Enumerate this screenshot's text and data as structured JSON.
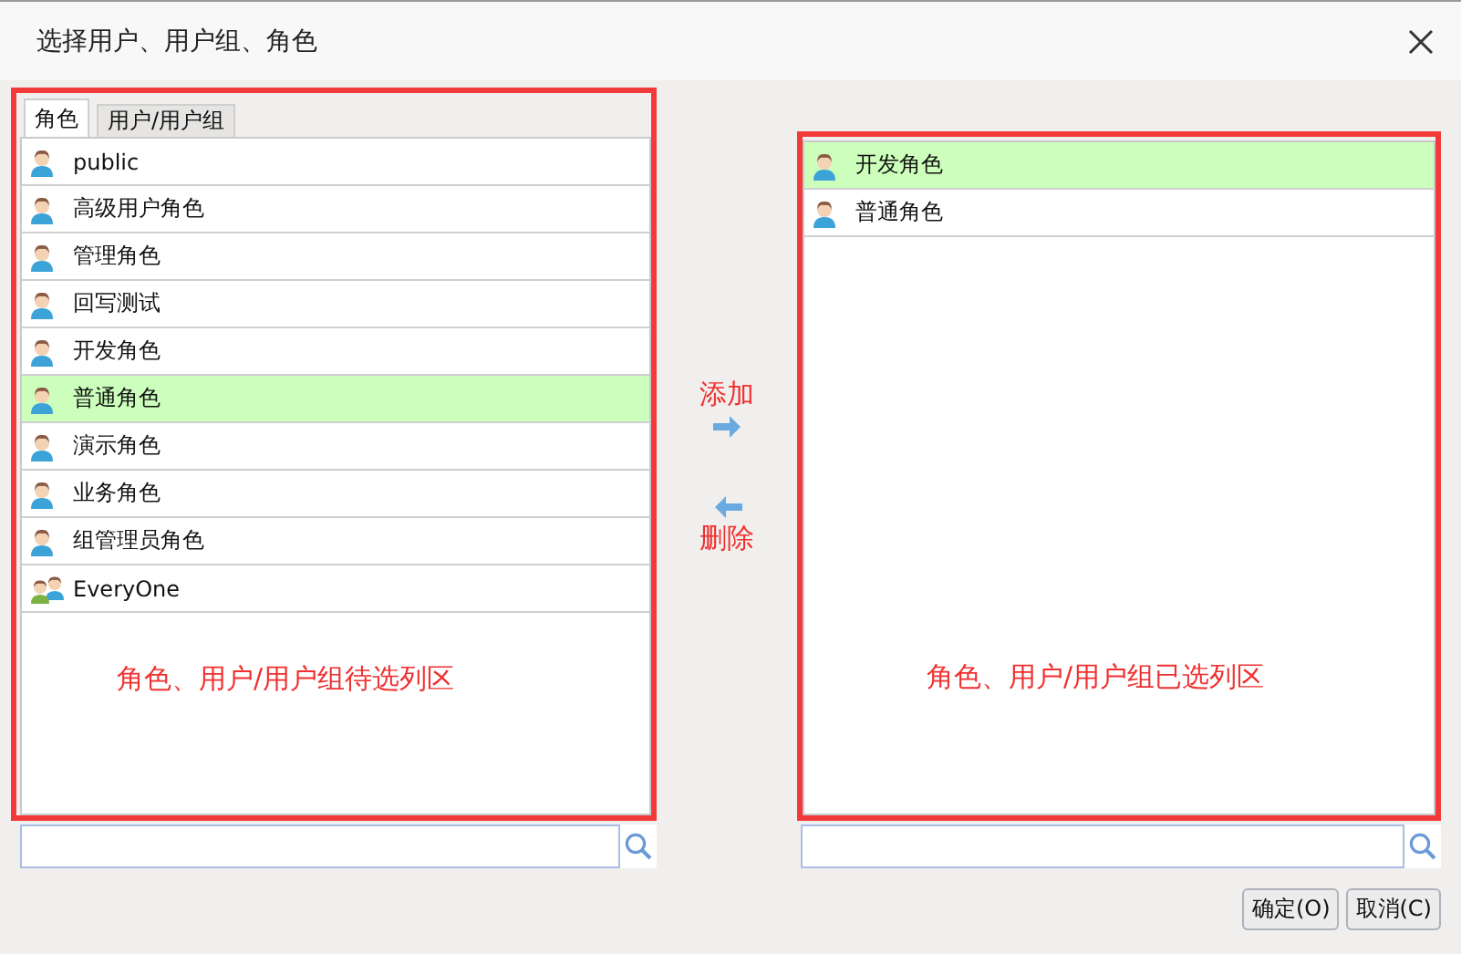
{
  "window": {
    "title": "选择用户、用户组、角色"
  },
  "tabs": [
    {
      "label": "角色",
      "selected": true
    },
    {
      "label": "用户/用户组",
      "selected": false
    }
  ],
  "available": {
    "items": [
      {
        "name": "public",
        "kind": "user",
        "selected": false
      },
      {
        "name": "高级用户角色",
        "kind": "user",
        "selected": false
      },
      {
        "name": "管理角色",
        "kind": "user",
        "selected": false
      },
      {
        "name": "回写测试",
        "kind": "user",
        "selected": false
      },
      {
        "name": "开发角色",
        "kind": "user",
        "selected": false
      },
      {
        "name": "普通角色",
        "kind": "user",
        "selected": true
      },
      {
        "name": "演示角色",
        "kind": "user",
        "selected": false
      },
      {
        "name": "业务角色",
        "kind": "user",
        "selected": false
      },
      {
        "name": "组管理员角色",
        "kind": "user",
        "selected": false
      },
      {
        "name": "EveryOne",
        "kind": "group",
        "selected": false
      }
    ],
    "annotation": "角色、用户/用户组待选列区"
  },
  "actions": {
    "add": "添加",
    "remove": "删除"
  },
  "chosen": {
    "items": [
      {
        "name": "开发角色",
        "kind": "user",
        "selected": true
      },
      {
        "name": "普通角色",
        "kind": "user",
        "selected": false
      }
    ],
    "annotation": "角色、用户/用户组已选列区"
  },
  "buttons": [
    "确定(O)",
    "取消(C)"
  ]
}
